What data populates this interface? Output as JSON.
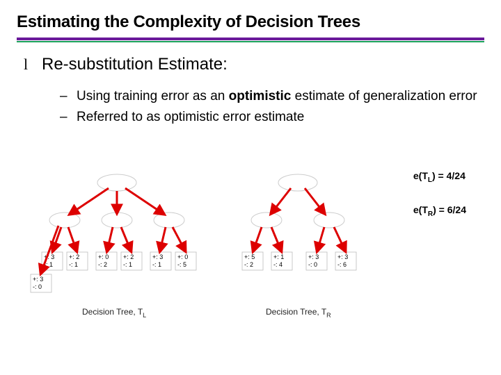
{
  "title": "Estimating the Complexity of Decision Trees",
  "bullet": {
    "mark": "l",
    "text": "Re-substitution Estimate:"
  },
  "sub": [
    {
      "dash": "–",
      "pre": "Using training error as an ",
      "bold": "optimistic",
      "post": " estimate of generalization error"
    },
    {
      "dash": "–",
      "pre": "Referred to as optimistic error estimate",
      "bold": "",
      "post": ""
    }
  ],
  "equations": {
    "eL_label": "e(T",
    "eL_sub": "L",
    "eL_tail": ") = 4/24",
    "eR_label": "e(T",
    "eR_sub": "R",
    "eR_tail": ") = 6/24"
  },
  "trees": {
    "left": {
      "caption": "Decision Tree, T",
      "caption_sub": "L",
      "leaves": [
        {
          "pos": "+: 3",
          "neg": "-: 0"
        },
        {
          "pos": "+: 3",
          "neg": "-: 1"
        },
        {
          "pos": "+: 2",
          "neg": "-: 1"
        },
        {
          "pos": "+: 0",
          "neg": "-: 2"
        },
        {
          "pos": "+: 2",
          "neg": "-: 1"
        },
        {
          "pos": "+: 3",
          "neg": "-: 1"
        },
        {
          "pos": "+: 0",
          "neg": "-: 5"
        }
      ]
    },
    "right": {
      "caption": "Decision Tree, T",
      "caption_sub": "R",
      "leaves": [
        {
          "pos": "+: 5",
          "neg": "-: 2"
        },
        {
          "pos": "+: 1",
          "neg": "-: 4"
        },
        {
          "pos": "+: 3",
          "neg": "-: 0"
        },
        {
          "pos": "+: 3",
          "neg": "-: 6"
        }
      ]
    }
  }
}
